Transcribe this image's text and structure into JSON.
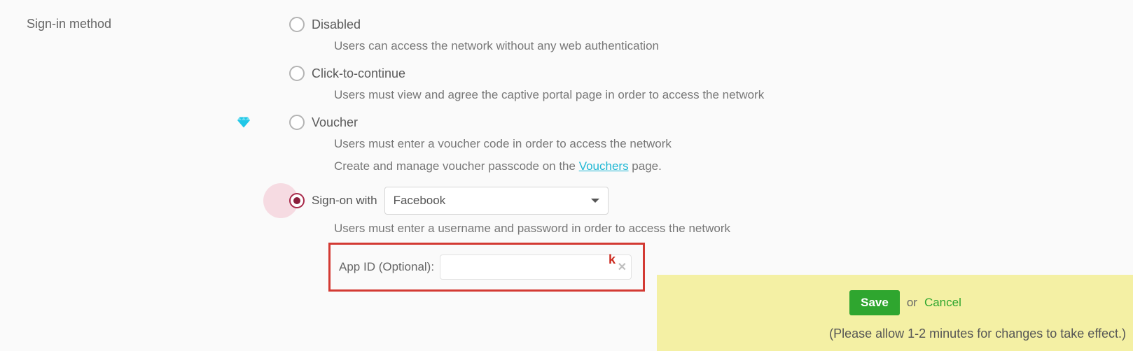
{
  "section": {
    "title": "Sign-in method"
  },
  "options": {
    "disabled": {
      "label": "Disabled",
      "desc": "Users can access the network without any web authentication"
    },
    "click": {
      "label": "Click-to-continue",
      "desc": "Users must view and agree the captive portal page in order to access the network"
    },
    "voucher": {
      "label": "Voucher",
      "desc": "Users must enter a voucher code in order to access the network",
      "create_prefix": "Create and manage voucher passcode on the ",
      "link_text": "Vouchers",
      "create_suffix": " page."
    },
    "signon": {
      "label": "Sign-on with",
      "provider": "Facebook",
      "desc": "Users must enter a username and password in order to access the network",
      "appid_label": "App ID (Optional):",
      "appid_value": "",
      "annot": "k"
    }
  },
  "savebar": {
    "save": "Save",
    "or": "or",
    "cancel": "Cancel",
    "note": "(Please allow 1-2 minutes for changes to take effect.)"
  }
}
